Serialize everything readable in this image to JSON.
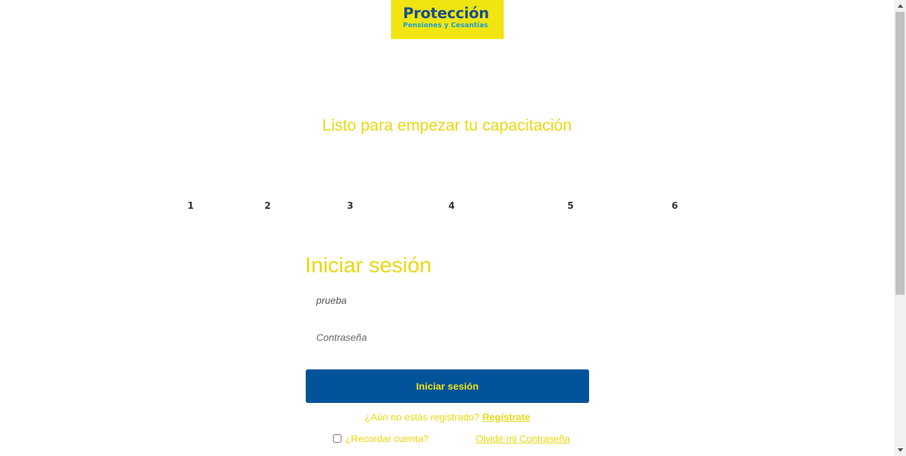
{
  "brand": {
    "name": "Protección",
    "tagline": "Pensiones y Cesantías",
    "logo_bg": "#f0e510",
    "logo_text_color": "#1a4f8c",
    "logo_sub_color": "#1a9fd3"
  },
  "hero": {
    "title": "Listo para empezar tu capacitación"
  },
  "steps": [
    "1",
    "2",
    "3",
    "4",
    "5",
    "6"
  ],
  "login": {
    "title": "Iniciar sesión",
    "username_value": "prueba",
    "password_placeholder": "Contraseña",
    "submit_label": "Iniciar sesión",
    "register_prompt": "¿Aún no estás registrado?",
    "register_link": "Regístrate",
    "remember_label": "¿Recordar cuenta?",
    "remember_checked": false,
    "forgot_link": "Olvidé mi Contraseña"
  },
  "colors": {
    "accent_yellow": "#ecd812",
    "button_blue": "#03539b"
  }
}
